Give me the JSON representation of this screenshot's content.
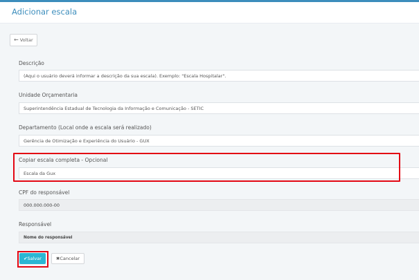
{
  "header": {
    "title": "Adicionar escala"
  },
  "toolbar": {
    "back_icon": "←",
    "back_label": "Voltar"
  },
  "form": {
    "descricao": {
      "label": "Descrição",
      "placeholder": "(Aqui o usuário deverá informar a descrição da sua escala). Exemplo: \"Escala Hospitalar\"."
    },
    "unidade": {
      "label": "Unidade Orçamentaria",
      "value": "Superintendência Estadual de Tecnologia da Informação e Comunicação - SETIC"
    },
    "departamento": {
      "label": "Departamento (Local onde a escala será realizado)",
      "value": "Gerência de Otimização e Experiência do Usuário - GUX"
    },
    "copiar": {
      "label": "Copiar escala completa - Opcional",
      "value": "Escala da Gux"
    },
    "cpf": {
      "label": "CPF do responsável",
      "value": "000.000.000-00"
    },
    "responsavel": {
      "label": "Responsável",
      "value": "Nome do responsável"
    }
  },
  "actions": {
    "save_icon": "✔",
    "save_label": "Salvar",
    "cancel_icon": "✖",
    "cancel_label": "Cancelar"
  },
  "colors": {
    "accent": "#3c8dbc",
    "save_button": "#2bb6d3",
    "highlight": "#e30613"
  }
}
